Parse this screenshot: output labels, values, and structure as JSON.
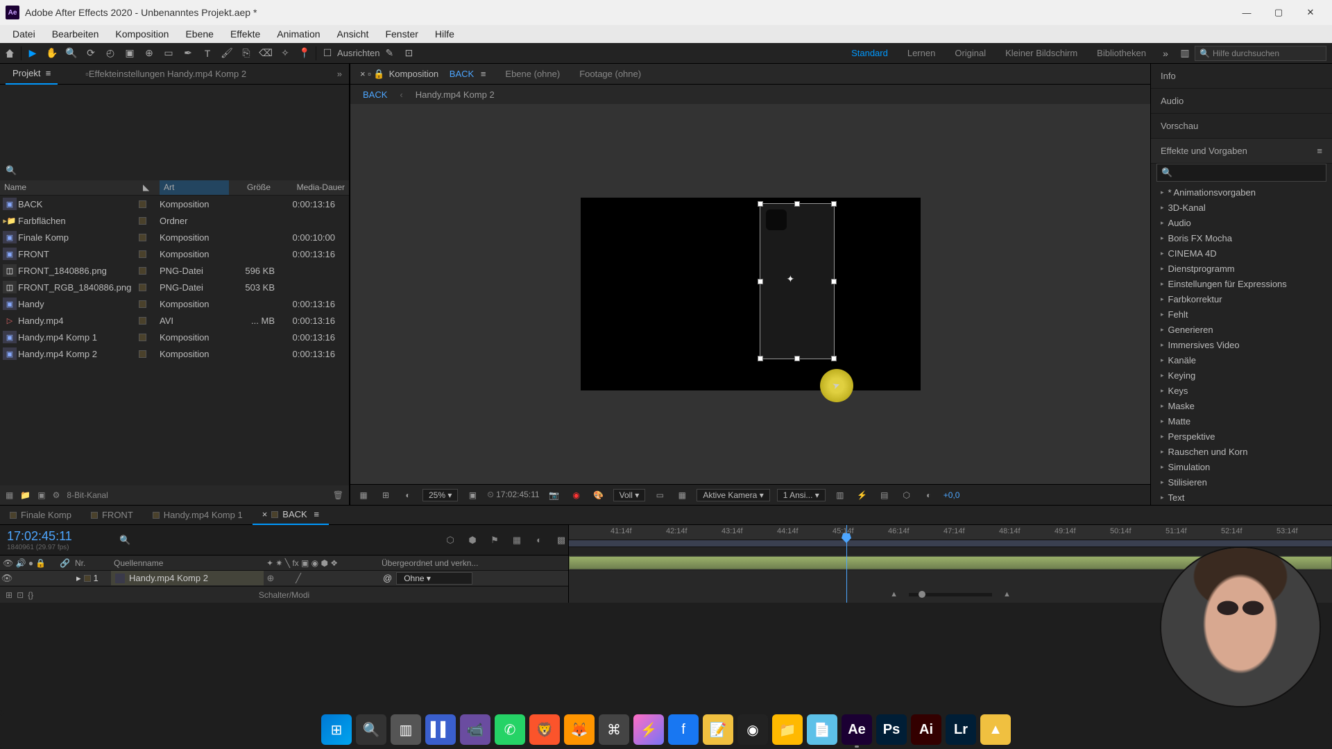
{
  "titlebar": {
    "app": "Adobe After Effects 2020",
    "project": "Unbenanntes Projekt.aep *"
  },
  "menu": [
    "Datei",
    "Bearbeiten",
    "Komposition",
    "Ebene",
    "Effekte",
    "Animation",
    "Ansicht",
    "Fenster",
    "Hilfe"
  ],
  "toolbar": {
    "align_label": "Ausrichten"
  },
  "workspaces": {
    "items": [
      "Standard",
      "Lernen",
      "Original",
      "Kleiner Bildschirm",
      "Bibliotheken"
    ],
    "active": "Standard"
  },
  "search_placeholder": "Hilfe durchsuchen",
  "project": {
    "tab_project": "Projekt",
    "tab_effects": "Effekteinstellungen Handy.mp4 Komp 2",
    "header": {
      "name": "Name",
      "art": "Art",
      "size": "Größe",
      "dur": "Media-Dauer"
    },
    "rows": [
      {
        "icon": "comp",
        "name": "BACK",
        "art": "Komposition",
        "size": "",
        "dur": "0:00:13:16"
      },
      {
        "icon": "folder",
        "name": "Farbflächen",
        "art": "Ordner",
        "size": "",
        "dur": ""
      },
      {
        "icon": "comp",
        "name": "Finale Komp",
        "art": "Komposition",
        "size": "",
        "dur": "0:00:10:00"
      },
      {
        "icon": "comp",
        "name": "FRONT",
        "art": "Komposition",
        "size": "",
        "dur": "0:00:13:16"
      },
      {
        "icon": "png",
        "name": "FRONT_1840886.png",
        "art": "PNG-Datei",
        "size": "596 KB",
        "dur": ""
      },
      {
        "icon": "png",
        "name": "FRONT_RGB_1840886.png",
        "art": "PNG-Datei",
        "size": "503 KB",
        "dur": ""
      },
      {
        "icon": "comp",
        "name": "Handy",
        "art": "Komposition",
        "size": "",
        "dur": "0:00:13:16"
      },
      {
        "icon": "avi",
        "name": "Handy.mp4",
        "art": "AVI",
        "size": "... MB",
        "dur": "0:00:13:16"
      },
      {
        "icon": "comp",
        "name": "Handy.mp4 Komp 1",
        "art": "Komposition",
        "size": "",
        "dur": "0:00:13:16"
      },
      {
        "icon": "comp",
        "name": "Handy.mp4 Komp 2",
        "art": "Komposition",
        "size": "",
        "dur": "0:00:13:16"
      }
    ],
    "footer_bpc": "8-Bit-Kanal"
  },
  "comp": {
    "tab_comp_prefix": "Komposition",
    "tab_comp_name": "BACK",
    "tab_layer": "Ebene  (ohne)",
    "tab_footage": "Footage  (ohne)",
    "breadcrumb": [
      "BACK",
      "Handy.mp4 Komp 2"
    ],
    "footer": {
      "zoom": "25%",
      "timecode": "17:02:45:11",
      "res": "Voll",
      "camera": "Aktive Kamera",
      "view": "1 Ansi...",
      "exposure": "+0,0"
    }
  },
  "right": {
    "panels": [
      "Info",
      "Audio",
      "Vorschau"
    ],
    "effects_title": "Effekte und Vorgaben",
    "categories": [
      "* Animationsvorgaben",
      "3D-Kanal",
      "Audio",
      "Boris FX Mocha",
      "CINEMA 4D",
      "Dienstprogramm",
      "Einstellungen für Expressions",
      "Farbkorrektur",
      "Fehlt",
      "Generieren",
      "Immersives Video",
      "Kanäle",
      "Keying",
      "Keys",
      "Maske",
      "Matte",
      "Perspektive",
      "Rauschen und Korn",
      "Simulation",
      "Stilisieren",
      "Text"
    ]
  },
  "timeline": {
    "tabs": [
      "Finale Komp",
      "FRONT",
      "Handy.mp4 Komp 1",
      "BACK"
    ],
    "active_tab": "BACK",
    "timecode": "17:02:45:11",
    "sub_timecode": "1840961 (29.97 fps)",
    "col_nr": "Nr.",
    "col_source": "Quellenname",
    "col_parent": "Übergeordnet und verkn...",
    "layer": {
      "num": "1",
      "name": "Handy.mp4 Komp 2",
      "parent": "Ohne"
    },
    "footer_label": "Schalter/Modi",
    "ruler": [
      "41:14f",
      "42:14f",
      "43:14f",
      "44:14f",
      "45:14f",
      "46:14f",
      "47:14f",
      "48:14f",
      "49:14f",
      "50:14f",
      "51:14f",
      "52:14f",
      "53:14f"
    ]
  }
}
